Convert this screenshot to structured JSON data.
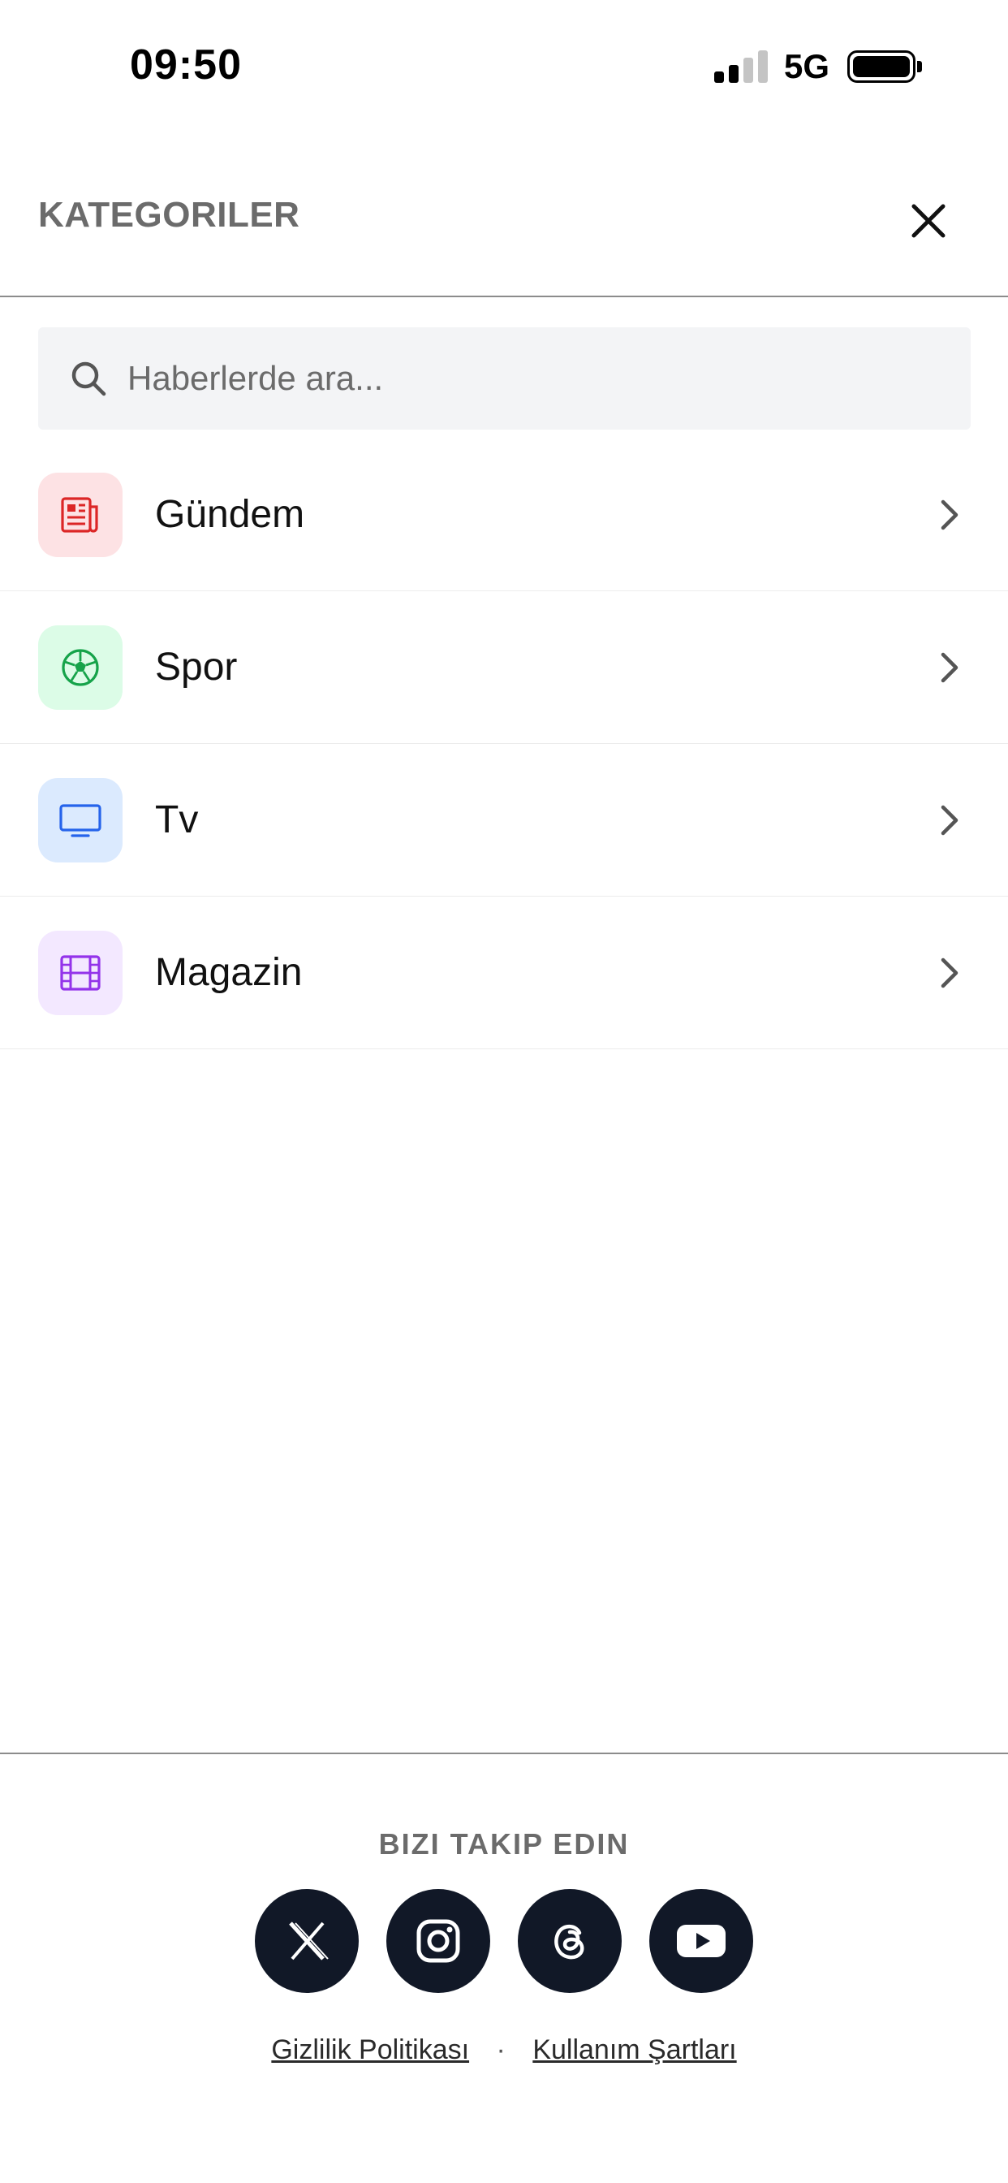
{
  "status_bar": {
    "time": "09:50",
    "network": "5G"
  },
  "header": {
    "title": "KATEGORILER",
    "close_icon": "close-icon"
  },
  "search": {
    "placeholder": "Haberlerde ara...",
    "value": "",
    "icon": "search-icon"
  },
  "categories": [
    {
      "label": "Gündem",
      "icon": "newspaper-icon",
      "bg": "#fde2e4",
      "color": "#dc2626"
    },
    {
      "label": "Spor",
      "icon": "soccer-ball-icon",
      "bg": "#dcfce7",
      "color": "#16a34a"
    },
    {
      "label": "Tv",
      "icon": "tv-icon",
      "bg": "#dbeafe",
      "color": "#2563eb"
    },
    {
      "label": "Magazin",
      "icon": "film-icon",
      "bg": "#f3e8ff",
      "color": "#9333ea"
    }
  ],
  "footer": {
    "follow_title": "BIZI TAKIP EDIN",
    "socials": [
      "x-icon",
      "instagram-icon",
      "threads-icon",
      "youtube-icon"
    ],
    "links": {
      "privacy": "Gizlilik Politikası",
      "separator": "·",
      "terms": "Kullanım Şartları"
    }
  },
  "colors": {
    "social_bg": "#111827",
    "muted_text": "#6b6b6b",
    "search_bg": "#f3f4f6"
  }
}
